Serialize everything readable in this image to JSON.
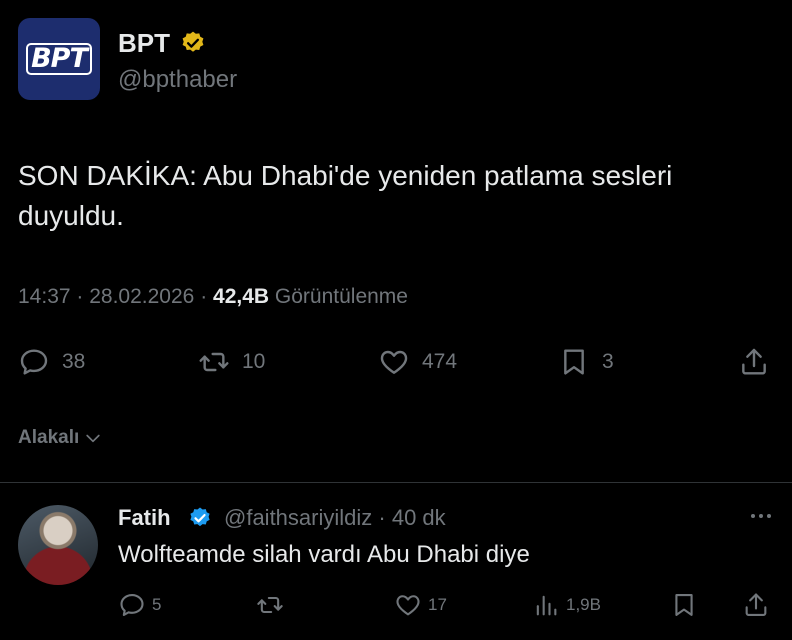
{
  "post": {
    "avatar_text": "BPT",
    "author_name": "BPT",
    "author_handle": "@bpthaber",
    "text": "SON DAKİKA: Abu Dhabi'de yeniden patlama sesleri duyuldu.",
    "time": "14:37",
    "date": "28.02.2026",
    "views_count": "42,4B",
    "views_label": "Görüntülenme",
    "replies": "38",
    "reposts": "10",
    "likes": "474",
    "bookmarks": "3"
  },
  "sort": {
    "label": "Alakalı"
  },
  "reply": {
    "author_name": "Fatih",
    "author_handle": "@faithsariyildiz",
    "age": "40 dk",
    "text": "Wolfteamde silah vardı Abu Dhabi diye",
    "replies": "5",
    "reposts": "",
    "likes": "17",
    "views": "1,9B"
  },
  "colors": {
    "background": "#000000",
    "text": "#e7e9ea",
    "muted": "#71767b",
    "verified_gold": "#e2b719",
    "verified_blue": "#1d9bf0",
    "avatar_bg": "#1d2d6e"
  },
  "icons": [
    "verified-gold-icon",
    "verified-blue-icon",
    "reply-icon",
    "repost-icon",
    "like-icon",
    "bookmark-icon",
    "share-icon",
    "views-icon",
    "more-icon",
    "chevron-down-icon"
  ]
}
